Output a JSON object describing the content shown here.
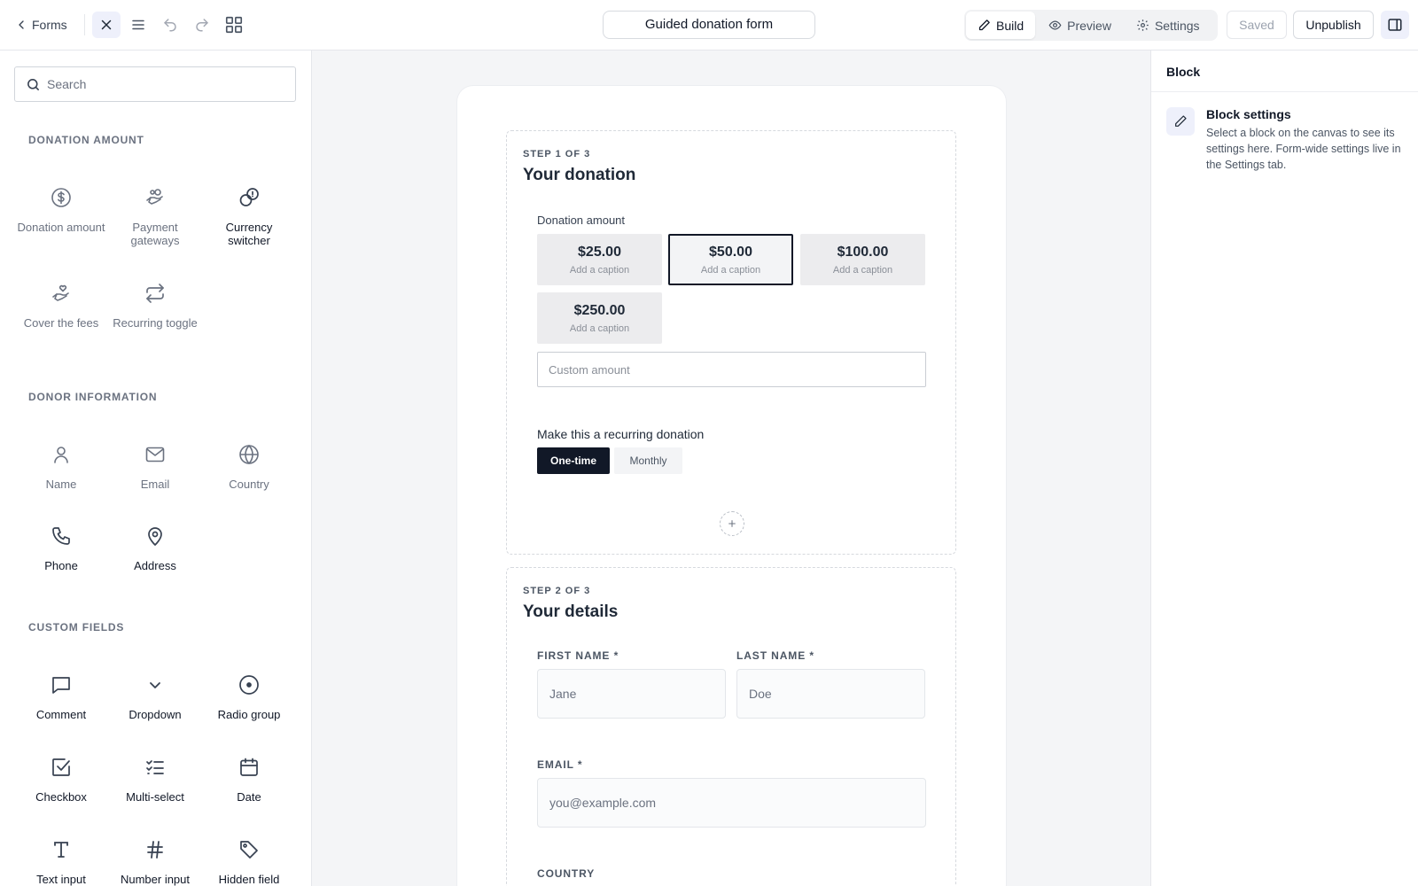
{
  "topbar": {
    "back_label": "Forms",
    "form_title": "Guided donation form",
    "tabs": [
      {
        "label": "Build",
        "icon": "pencil-icon",
        "active": true
      },
      {
        "label": "Preview",
        "icon": "eye-icon",
        "active": false
      },
      {
        "label": "Settings",
        "icon": "gear-icon",
        "active": false
      }
    ],
    "saved_label": "Saved",
    "unpublish_label": "Unpublish"
  },
  "sidebar": {
    "search_placeholder": "Search",
    "sections": [
      {
        "title": "DONATION AMOUNT",
        "items": [
          {
            "label": "Donation amount",
            "icon": "dollar-circle-icon"
          },
          {
            "label": "Payment gateways",
            "icon": "hand-coins-icon"
          },
          {
            "label": "Currency switcher",
            "icon": "currency-switch-icon"
          },
          {
            "label": "Cover the fees",
            "icon": "hand-heart-icon"
          },
          {
            "label": "Recurring toggle",
            "icon": "repeat-icon"
          }
        ]
      },
      {
        "title": "DONOR INFORMATION",
        "items": [
          {
            "label": "Name",
            "icon": "user-icon"
          },
          {
            "label": "Email",
            "icon": "mail-icon"
          },
          {
            "label": "Country",
            "icon": "globe-icon"
          },
          {
            "label": "Phone",
            "icon": "phone-icon"
          },
          {
            "label": "Address",
            "icon": "map-pin-icon"
          }
        ]
      },
      {
        "title": "CUSTOM FIELDS",
        "items": [
          {
            "label": "Comment",
            "icon": "message-square-icon"
          },
          {
            "label": "Dropdown",
            "icon": "chevron-down-icon"
          },
          {
            "label": "Radio group",
            "icon": "radio-icon"
          },
          {
            "label": "Checkbox",
            "icon": "checkbox-icon"
          },
          {
            "label": "Multi-select",
            "icon": "list-checks-icon"
          },
          {
            "label": "Date",
            "icon": "calendar-icon"
          },
          {
            "label": "Text input",
            "icon": "type-icon"
          },
          {
            "label": "Number input",
            "icon": "hash-icon"
          },
          {
            "label": "Hidden field",
            "icon": "tag-icon"
          }
        ]
      }
    ]
  },
  "canvas": {
    "step1": {
      "label": "STEP 1 OF 3",
      "title": "Your donation",
      "amount_label": "Donation amount",
      "amounts": [
        {
          "value": "$25.00",
          "caption": "Add a caption",
          "selected": false
        },
        {
          "value": "$50.00",
          "caption": "Add a caption",
          "selected": true
        },
        {
          "value": "$100.00",
          "caption": "Add a caption",
          "selected": false
        },
        {
          "value": "$250.00",
          "caption": "Add a caption",
          "selected": false
        }
      ],
      "custom_amount_placeholder": "Custom amount",
      "recurring_label": "Make this a recurring donation",
      "recurring_options": [
        "One-time",
        "Monthly"
      ],
      "recurring_selected": "One-time"
    },
    "step2": {
      "label": "STEP 2 OF 3",
      "title": "Your details",
      "first_name_label": "FIRST NAME",
      "first_name_placeholder": "Jane",
      "last_name_label": "LAST NAME",
      "last_name_placeholder": "Doe",
      "email_label": "EMAIL",
      "email_placeholder": "you@example.com",
      "country_label": "COUNTRY",
      "required_mark": "*"
    }
  },
  "rpanel": {
    "header": "Block",
    "info_title": "Block settings",
    "info_desc": "Select a block on the canvas to see its settings here. Form-wide settings live in the Settings tab."
  }
}
